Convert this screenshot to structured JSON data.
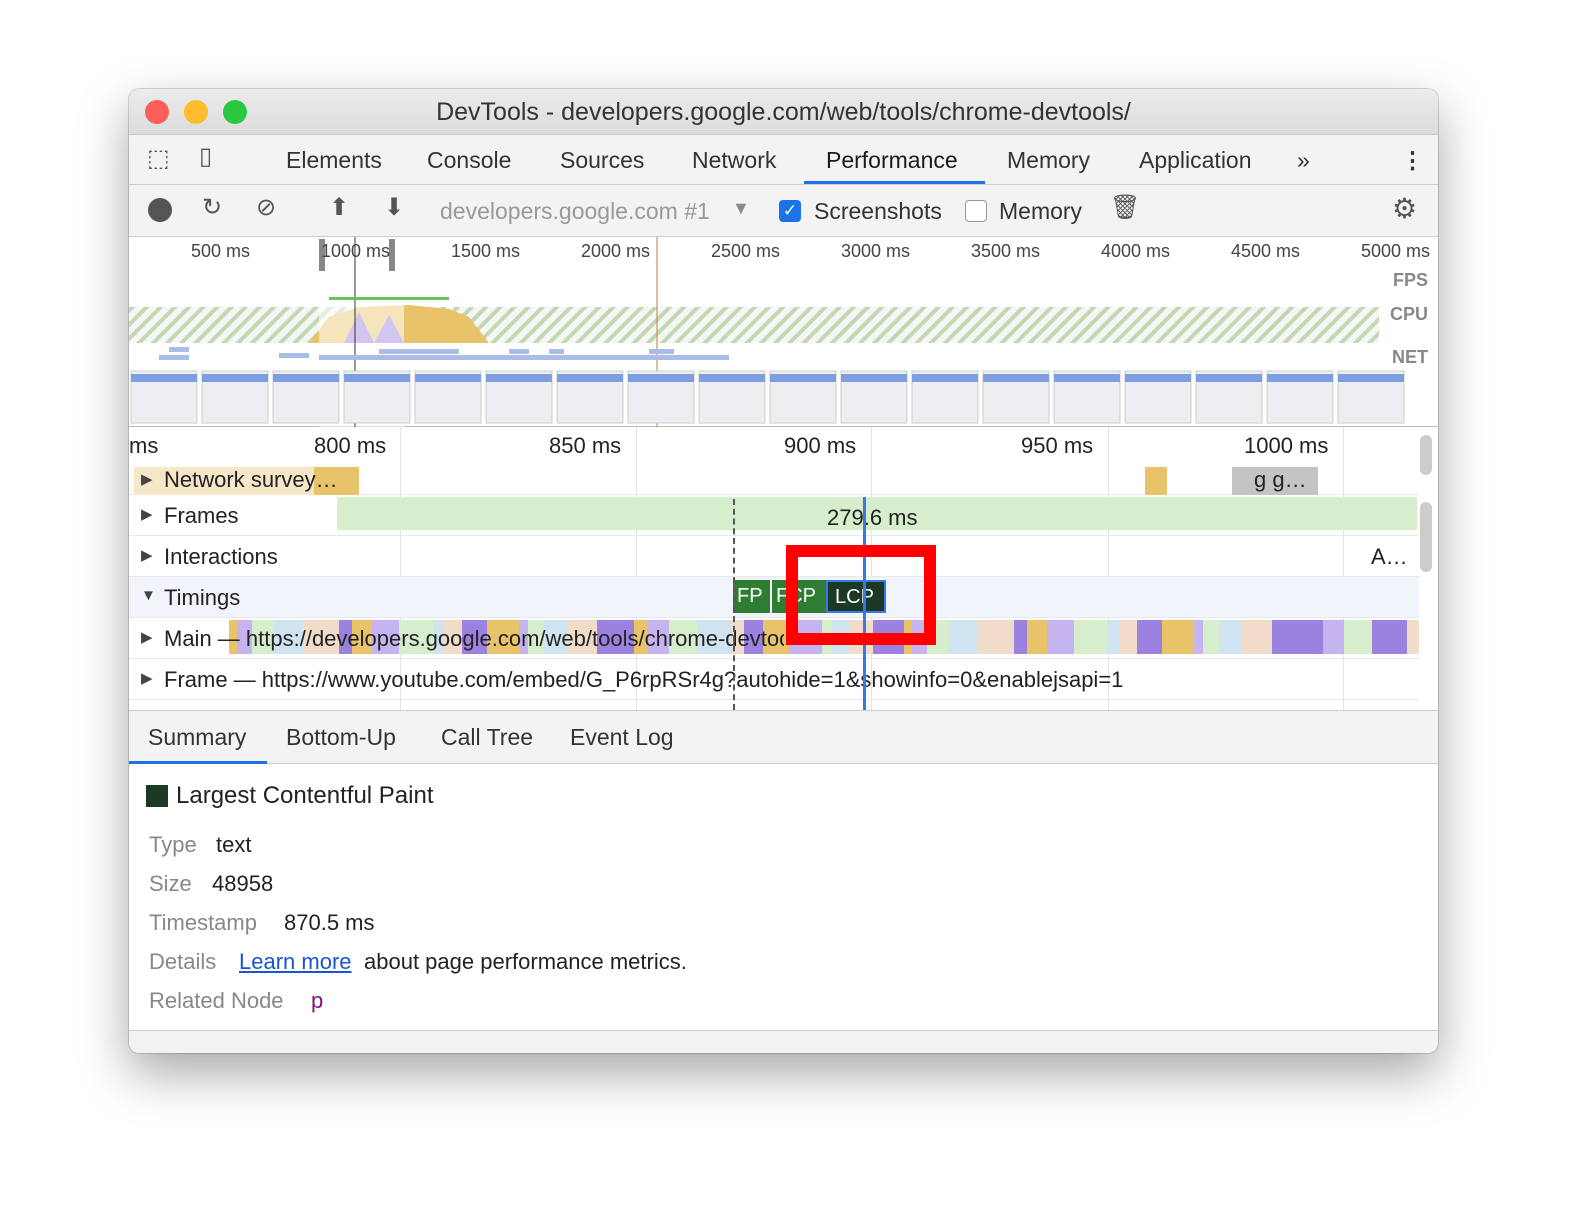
{
  "window": {
    "title": "DevTools - developers.google.com/web/tools/chrome-devtools/"
  },
  "tabs": [
    {
      "label": "Elements"
    },
    {
      "label": "Console"
    },
    {
      "label": "Sources"
    },
    {
      "label": "Network"
    },
    {
      "label": "Performance",
      "active": true
    },
    {
      "label": "Memory"
    },
    {
      "label": "Application"
    }
  ],
  "toolbar": {
    "target": "developers.google.com #1",
    "screenshots_label": "Screenshots",
    "screenshots_checked": true,
    "memory_label": "Memory",
    "memory_checked": false
  },
  "overview": {
    "ticks": [
      "500 ms",
      "1000 ms",
      "1500 ms",
      "2000 ms",
      "2500 ms",
      "3000 ms",
      "3500 ms",
      "4000 ms",
      "4500 ms",
      "5000 ms"
    ],
    "lanes": [
      "FPS",
      "CPU",
      "NET"
    ]
  },
  "flame": {
    "ticks": [
      "ms",
      "800 ms",
      "850 ms",
      "900 ms",
      "950 ms",
      "1000 ms"
    ],
    "network_label": "Network",
    "network_item": "survey…",
    "network_item2": "g g…",
    "frames_label": "Frames",
    "frame_duration": "279.6 ms",
    "interactions_label": "Interactions",
    "interaction_item": "A…",
    "timings_label": "Timings",
    "markers": [
      {
        "label": "FP",
        "color": "#2e7d32"
      },
      {
        "label": "FCP",
        "color": "#2e7d32"
      },
      {
        "label": "LCP",
        "color": "#1b3a26"
      }
    ],
    "main_label": "Main — https://developers.google.com/web/tools/chrome-devtools/",
    "frame_label": "Frame — https://www.youtube.com/embed/G_P6rpRSr4g?autohide=1&showinfo=0&enablejsapi=1"
  },
  "bottom_tabs": [
    {
      "label": "Summary",
      "active": true
    },
    {
      "label": "Bottom-Up"
    },
    {
      "label": "Call Tree"
    },
    {
      "label": "Event Log"
    }
  ],
  "summary": {
    "title": "Largest Contentful Paint",
    "swatch": "#1b3a26",
    "type_key": "Type",
    "type": "text",
    "size_key": "Size",
    "size": "48958",
    "timestamp_key": "Timestamp",
    "timestamp": "870.5 ms",
    "details_key": "Details",
    "learn_more": "Learn more",
    "details_rest": "about page performance metrics.",
    "node_key": "Related Node",
    "node": "p"
  },
  "highlight_color": "#ff0000"
}
